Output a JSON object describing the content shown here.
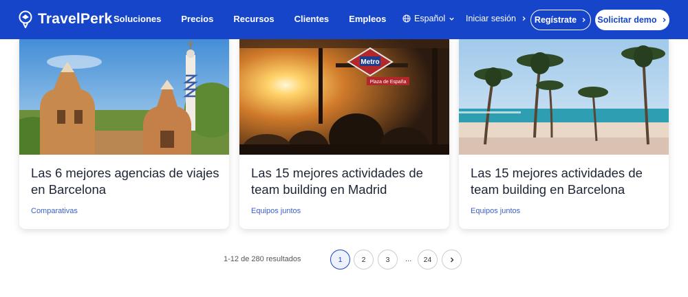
{
  "brand": {
    "name": "TravelPerk"
  },
  "nav": {
    "links": [
      "Soluciones",
      "Precios",
      "Recursos",
      "Clientes",
      "Empleos"
    ],
    "language": "Español",
    "login": "Iniciar sesión",
    "register": "Regístrate",
    "demo": "Solicitar demo"
  },
  "cards": [
    {
      "title": "Las 6 mejores agencias de viajes en Barcelona",
      "tag": "Comparativas"
    },
    {
      "title": "Las 15 mejores actividades de team building en Madrid",
      "tag": "Equipos juntos",
      "sign": "Metro",
      "plaza": "Plaza de España"
    },
    {
      "title": "Las 15 mejores actividades de team building en Barcelona",
      "tag": "Equipos juntos"
    }
  ],
  "pagination": {
    "results": "1-12 de 280 resultados",
    "pages": [
      "1",
      "2",
      "3",
      "24"
    ],
    "ellipsis": "...",
    "current": "1"
  },
  "colors": {
    "brand": "#1745c9",
    "tag": "#3a5ec9"
  },
  "icons": [
    "travelperk-logo-icon",
    "globe-icon",
    "chevron-down-icon",
    "chevron-right-icon"
  ]
}
